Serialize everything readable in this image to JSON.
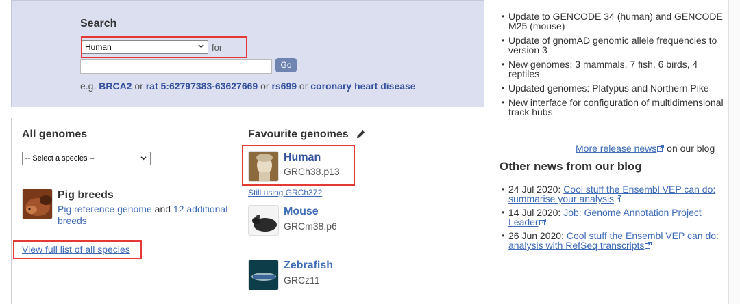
{
  "search": {
    "title": "Search",
    "species_selected": "Human",
    "for_label": "for",
    "query_value": "",
    "go_label": "Go",
    "examples_prefix": "e.g.",
    "examples": [
      "BRCA2",
      "rat 5:62797383-63627669",
      "rs699",
      "coronary heart disease"
    ],
    "or_word": "or"
  },
  "all_genomes": {
    "title": "All genomes",
    "select_placeholder": "-- Select a species --",
    "pig": {
      "title": "Pig breeds",
      "link1": "Pig reference genome",
      "and_word": "and",
      "link2": "12 additional breeds"
    },
    "view_all": "View full list of all species"
  },
  "favourites": {
    "title": "Favourite genomes",
    "species": [
      {
        "name": "Human",
        "assembly": "GRCh38.p13"
      },
      {
        "name": "Mouse",
        "assembly": "GRCm38.p6"
      },
      {
        "name": "Zebrafish",
        "assembly": "GRCz11"
      }
    ],
    "grch37_link": "Still using GRCh37?"
  },
  "release_news": {
    "items": [
      "Update to GENCODE 34 (human) and GENCODE M25 (mouse)",
      "Update of gnomAD genomic allele frequencies to version 3",
      "New genomes: 3 mammals, 7 fish, 6 birds, 4 reptiles",
      "Updated genomes: Platypus and Northern Pike",
      "New interface for configuration of multidimensional track hubs"
    ],
    "more_link": "More release news",
    "more_suffix": "on our blog"
  },
  "blog": {
    "title": "Other news from our blog",
    "items": [
      {
        "date": "24 Jul 2020:",
        "link": "Cool stuff the Ensembl VEP can do: summarise your analysis"
      },
      {
        "date": "14 Jul 2020:",
        "link": "Job: Genome Annotation Project Leader"
      },
      {
        "date": "26 Jun 2020:",
        "link": "Cool stuff the Ensembl VEP can do: analysis with RefSeq transcripts"
      }
    ]
  },
  "icons": [
    "chevron-down-icon",
    "pencil-icon",
    "external-link-icon"
  ],
  "colors": {
    "search_panel_bg": "#dbdff0",
    "link": "#3f6cb8",
    "link_bold": "#33519e",
    "go_button": "#6f84b1",
    "highlight": "#e53935"
  }
}
